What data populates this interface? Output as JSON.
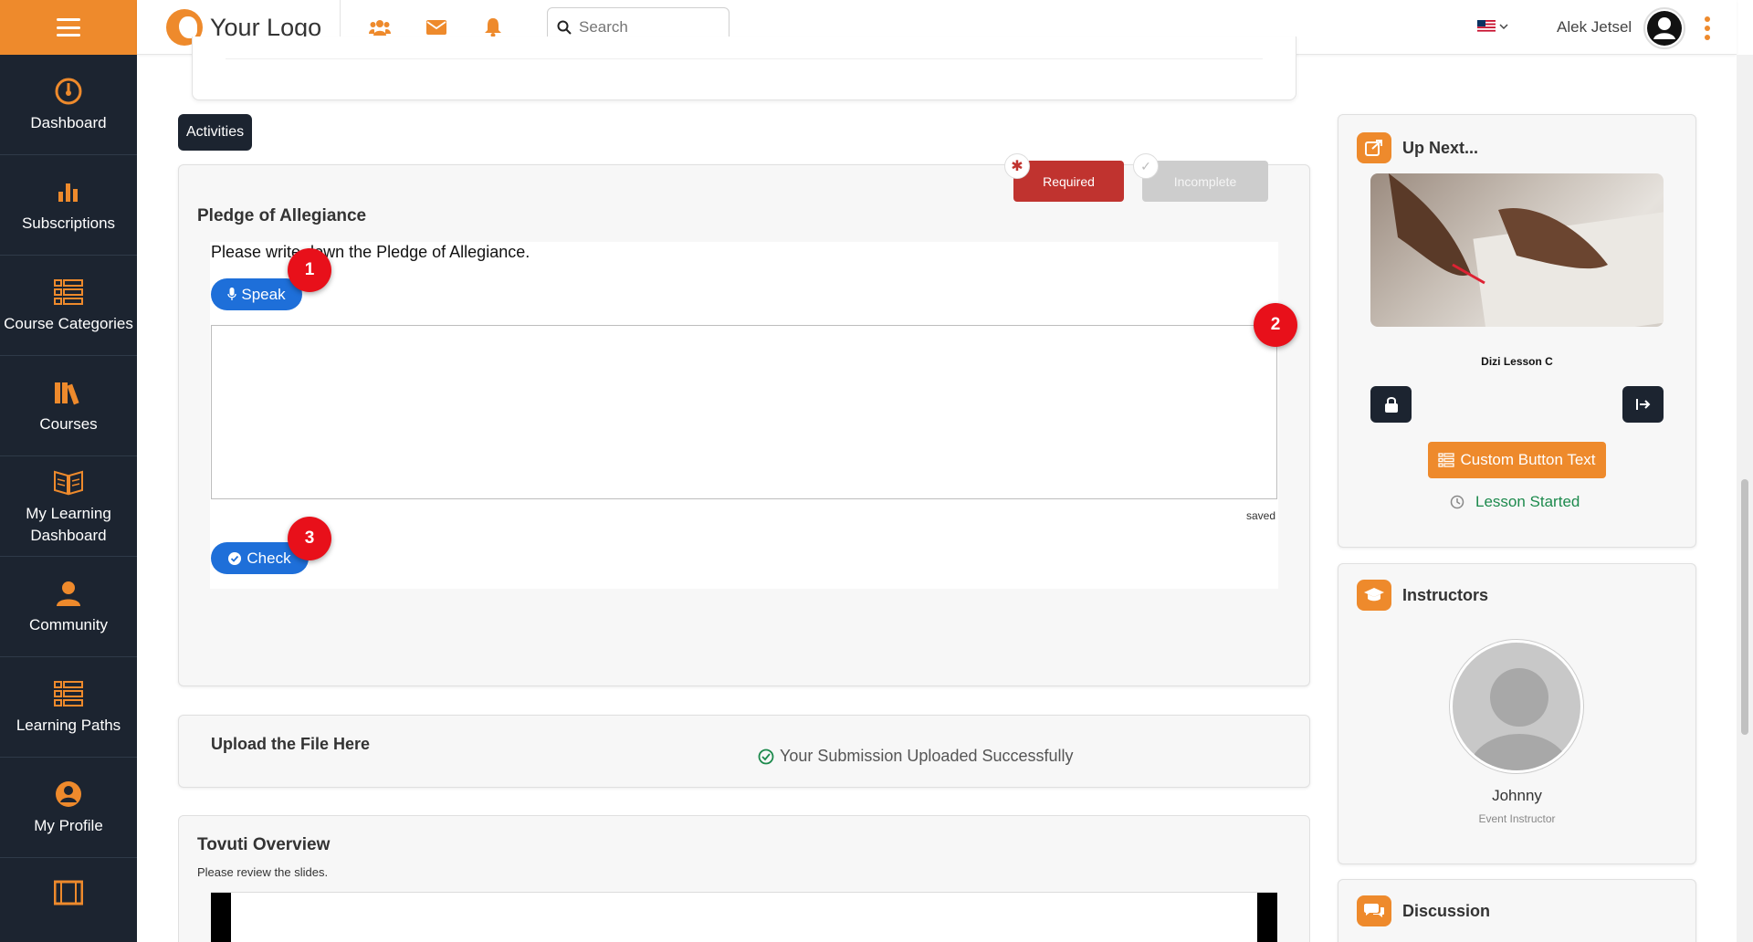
{
  "header": {
    "logo_text": "Your Logo",
    "search_placeholder": "Search",
    "user_name": "Alek Jetsel"
  },
  "sidebar": {
    "items": [
      {
        "label": "Dashboard",
        "icon": "speedometer-icon"
      },
      {
        "label": "Subscriptions",
        "icon": "bar-chart-icon"
      },
      {
        "label": "Course Categories",
        "icon": "list-icon"
      },
      {
        "label": "Courses",
        "icon": "books-icon"
      },
      {
        "label": "My Learning Dashboard",
        "icon": "open-book-icon"
      },
      {
        "label": "Community",
        "icon": "users-icon"
      },
      {
        "label": "Learning Paths",
        "icon": "list-icon"
      },
      {
        "label": "My Profile",
        "icon": "user-circle-icon"
      }
    ]
  },
  "main": {
    "tab_label": "Activities",
    "activity": {
      "title": "Pledge of Allegiance",
      "required_label": "Required",
      "incomplete_label": "Incomplete",
      "question": "Please write down the Pledge of Allegiance.",
      "speak_label": "Speak",
      "answer_value": "",
      "saved_label": "saved",
      "check_label": "Check"
    },
    "markers": [
      "1",
      "2",
      "3"
    ],
    "upload": {
      "title": "Upload the File Here",
      "status": "Your Submission Uploaded Successfully"
    },
    "overview": {
      "title": "Tovuti Overview",
      "subtitle": "Please review the slides."
    }
  },
  "right": {
    "up_next": {
      "title": "Up Next...",
      "lesson_name": "Dizi Lesson C",
      "custom_button": "Custom Button Text",
      "status": "Lesson Started"
    },
    "instructors": {
      "title": "Instructors",
      "name": "Johnny",
      "role": "Event Instructor"
    },
    "discussion": {
      "title": "Discussion"
    }
  },
  "colors": {
    "accent": "#ee8a2c",
    "sidebar_bg": "#1c2430",
    "primary_blue": "#1e6fd9",
    "required_red": "#c0332f",
    "marker_red": "#e8101a",
    "success_green": "#1d8a4d"
  }
}
